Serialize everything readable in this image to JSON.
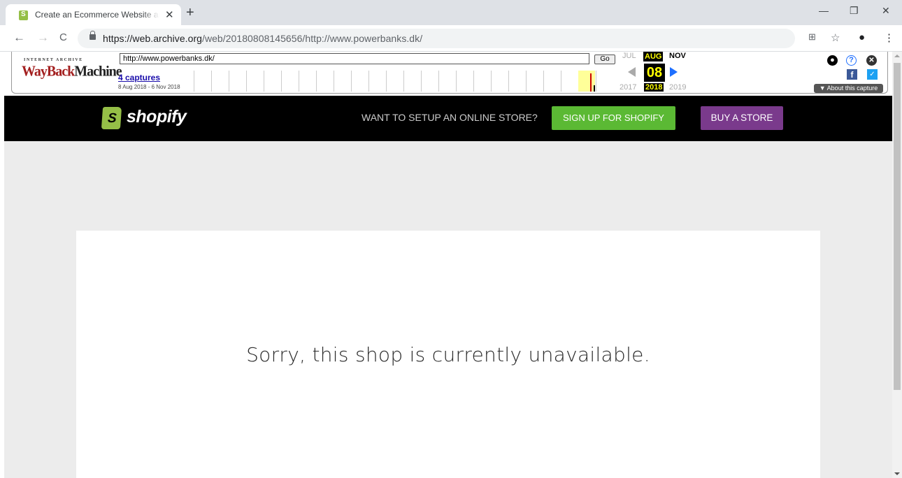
{
  "browser": {
    "tab_title": "Create an Ecommerce Website and Sell Online!",
    "tab_close": "✕",
    "new_tab": "+",
    "url_host": "https://web.archive.org",
    "url_path": "/web/20180808145656/http://www.powerbanks.dk/",
    "win_min": "—",
    "win_restore": "❐",
    "win_close": "✕",
    "back": "←",
    "forward": "→",
    "reload": "C",
    "translate_icon": "⊞",
    "star": "☆",
    "profile": "●",
    "menu": "⋮"
  },
  "wayback": {
    "logo_top": "INTERNET ARCHIVE",
    "logo_way": "WayBack",
    "logo_machine": "Machine",
    "url_value": "http://www.powerbanks.dk/",
    "go_label": "Go",
    "captures_label": "4 captures",
    "date_range": "8 Aug 2018 - 6 Nov 2018",
    "prev_month": "JUL",
    "cur_month": "AUG",
    "next_month": "NOV",
    "cur_day": "08",
    "prev_year": "2017",
    "cur_year": "2018",
    "next_year": "2019",
    "help_glyph": "?",
    "close_glyph": "✕",
    "fb_glyph": "f",
    "tw_glyph": "🐦",
    "about_label": "▼ About this capture"
  },
  "shopify": {
    "logo_text": "shopify",
    "prompt": "WANT TO SETUP AN ONLINE STORE?",
    "signup_label": "SIGN UP FOR SHOPIFY",
    "buy_label": "BUY A STORE"
  },
  "main": {
    "message": "Sorry, this shop is currently unavailable."
  }
}
